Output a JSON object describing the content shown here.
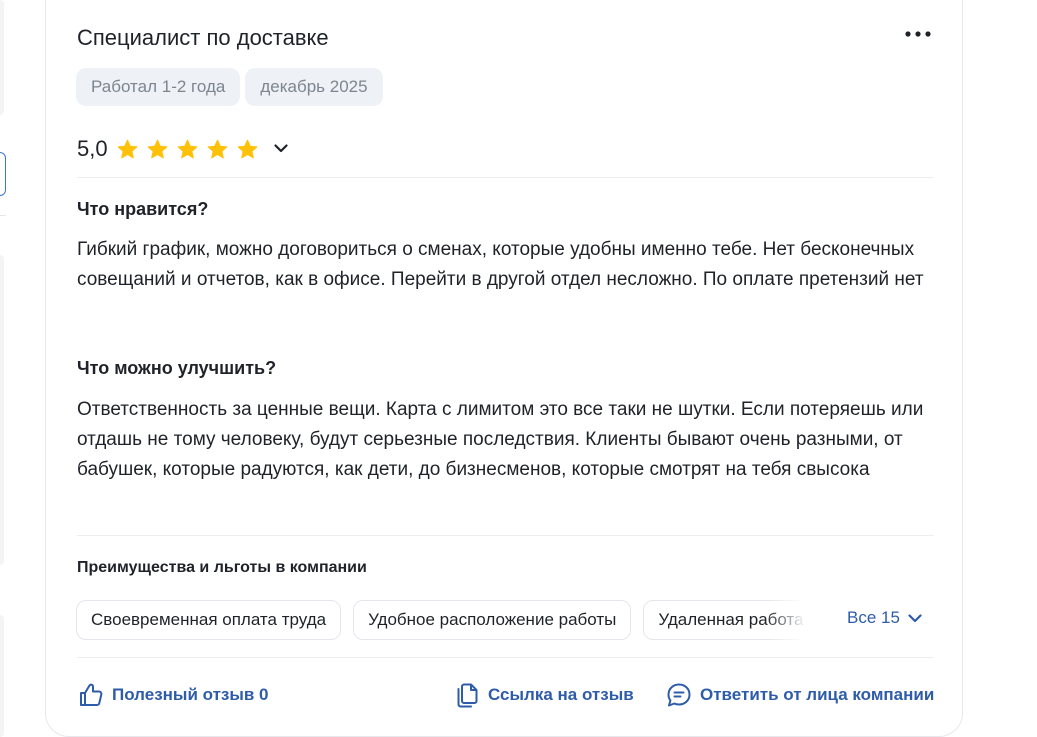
{
  "review": {
    "title": "Специалист по доставке",
    "meta_chips": [
      "Работал 1-2 года",
      "декабрь 2025"
    ],
    "rating": {
      "value_label": "5,0",
      "value": 5,
      "max": 5,
      "star_color": "#FFC107"
    },
    "likes": {
      "heading": "Что нравится?",
      "text": "Гибкий график, можно договориться о сменах, которые удобны именно тебе. Нет бесконечных совещаний и отчетов, как в офисе. Перейти в другой отдел несложно. По оплате претензий нет"
    },
    "improve": {
      "heading": "Что можно улучшить?",
      "text": "Ответственность за ценные вещи. Карта с лимитом это все таки не шутки. Если потеряешь или отдашь не тому человеку, будут серьезные последствия. Клиенты бывают очень разными, от бабушек, которые радуются, как дети, до бизнесменов, которые смотрят на тебя свысока"
    },
    "benefits": {
      "heading": "Преимущества и льготы в компании",
      "items": [
        "Своевременная оплата труда",
        "Удобное расположение работы",
        "Удаленная работа"
      ],
      "all_label": "Все 15"
    },
    "footer": {
      "useful_label": "Полезный отзыв 0",
      "link_label": "Ссылка на отзыв",
      "reply_label": "Ответить от лица компании"
    }
  },
  "colors": {
    "accent": "#2E5CA8",
    "chip_bg": "#EEF1F5",
    "chip_text": "#7D8590",
    "text": "#1F2329",
    "border": "#E6E8EB"
  },
  "icons": {
    "more": "more-horizontal-icon",
    "star": "star-icon",
    "chevron": "chevron-down-icon",
    "thumb": "thumbs-up-icon",
    "copy": "copy-link-icon",
    "reply": "chat-bubble-icon"
  }
}
